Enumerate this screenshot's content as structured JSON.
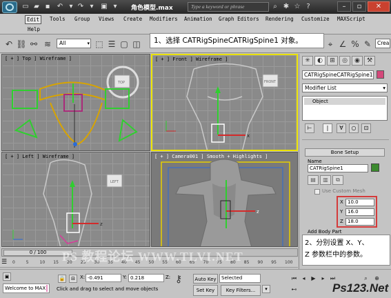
{
  "window": {
    "doc_title": "角色模型.max",
    "search_placeholder": "Type a keyword or phrase",
    "minimize": "–",
    "restore": "▫",
    "close": "✕"
  },
  "menu": [
    "Edit",
    "Tools",
    "Group",
    "Views",
    "Create",
    "Modifiers",
    "Animation",
    "Graph Editors",
    "Rendering",
    "Customize",
    "MAXScript",
    "Help"
  ],
  "toolbar": {
    "selection_filter": "All",
    "named_selection": "Crea"
  },
  "callouts": {
    "step1": "1、选择 CATRigSpineCATRigSpine1 对象。",
    "step2_line1": "2、分别设置 X、Y、",
    "step2_line2": "Z 参数栏中的参数。"
  },
  "viewports": {
    "top": "[ + ] Top ] Wireframe ]",
    "front": "[ + ] Front ] Wireframe ]",
    "left": "[ + ] Left ] Wireframe ]",
    "camera": "[ + ] Camera001 ] Smooth + Highlights ]",
    "viewcube_top": "TOP",
    "viewcube_front": "FRONT",
    "viewcube_left": "LEFT",
    "axis_x": "x",
    "axis_y": "y",
    "axis_z": "z"
  },
  "command_panel": {
    "object_name": "CATRigSpineCATRigSpine1",
    "object_color": "#d4487a",
    "modifier_list": "Modifier List",
    "stack_item": "Object",
    "bone_setup": {
      "title": "Bone Setup",
      "name_label": "Name",
      "name_value": "CATRigSpine1",
      "name_color": "#3b8a2e",
      "use_custom_mesh": "Use Custom Mesh",
      "x_label": "X",
      "x_value": "10.0",
      "y_label": "Y",
      "y_value": "16.0",
      "z_label": "Z",
      "z_value": "18.0",
      "add_body_part": "Add Body Part"
    }
  },
  "timeline": {
    "frame": "0 / 100",
    "ticks": [
      "0",
      "5",
      "10",
      "15",
      "20",
      "25",
      "30",
      "35",
      "40",
      "45",
      "50",
      "55",
      "60",
      "65",
      "70",
      "75",
      "80",
      "85",
      "90",
      "95",
      "100"
    ]
  },
  "status": {
    "maxscript": "Welcome to MAX",
    "message": "Click and drag to select and move objects",
    "x_label": "X:",
    "x_value": "-0.491",
    "y_label": "Y:",
    "y_value": "0.218",
    "z_label": "Z:",
    "auto_key": "Auto Key",
    "selected": "Selected",
    "set_key": "Set Key",
    "key_filters": "Key Filters..."
  },
  "watermarks": {
    "site": "PS 教程论坛 WWW.TLVI.NET",
    "logo": "Ps123.Net"
  }
}
